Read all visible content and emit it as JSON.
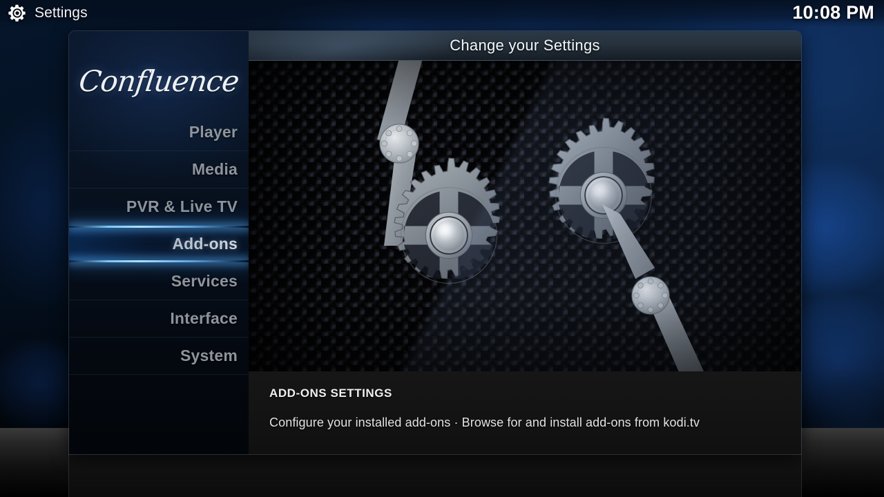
{
  "topbar": {
    "icon": "gear-icon",
    "title": "Settings",
    "clock": "10:08 PM"
  },
  "sidebar": {
    "logo": "Confluence",
    "items": [
      {
        "label": "Player",
        "selected": false
      },
      {
        "label": "Media",
        "selected": false
      },
      {
        "label": "PVR & Live TV",
        "selected": false
      },
      {
        "label": "Add-ons",
        "selected": true
      },
      {
        "label": "Services",
        "selected": false
      },
      {
        "label": "Interface",
        "selected": false
      },
      {
        "label": "System",
        "selected": false
      }
    ]
  },
  "main": {
    "title": "Change your Settings",
    "hero_image": "gears-on-perforated-metal-plate",
    "info": {
      "heading": "ADD-ONS SETTINGS",
      "description": "Configure your installed add-ons · Browse for and install add-ons from kodi.tv"
    }
  },
  "colors": {
    "accent": "#5ab4ff",
    "selected_text": "#ffffff",
    "menu_text": "#8e949c",
    "titlebar_text": "#f4f7fa",
    "wallpaper_blue": "#16468c",
    "metal_light": "#d8dde3",
    "metal_dark": "#6e757e"
  }
}
